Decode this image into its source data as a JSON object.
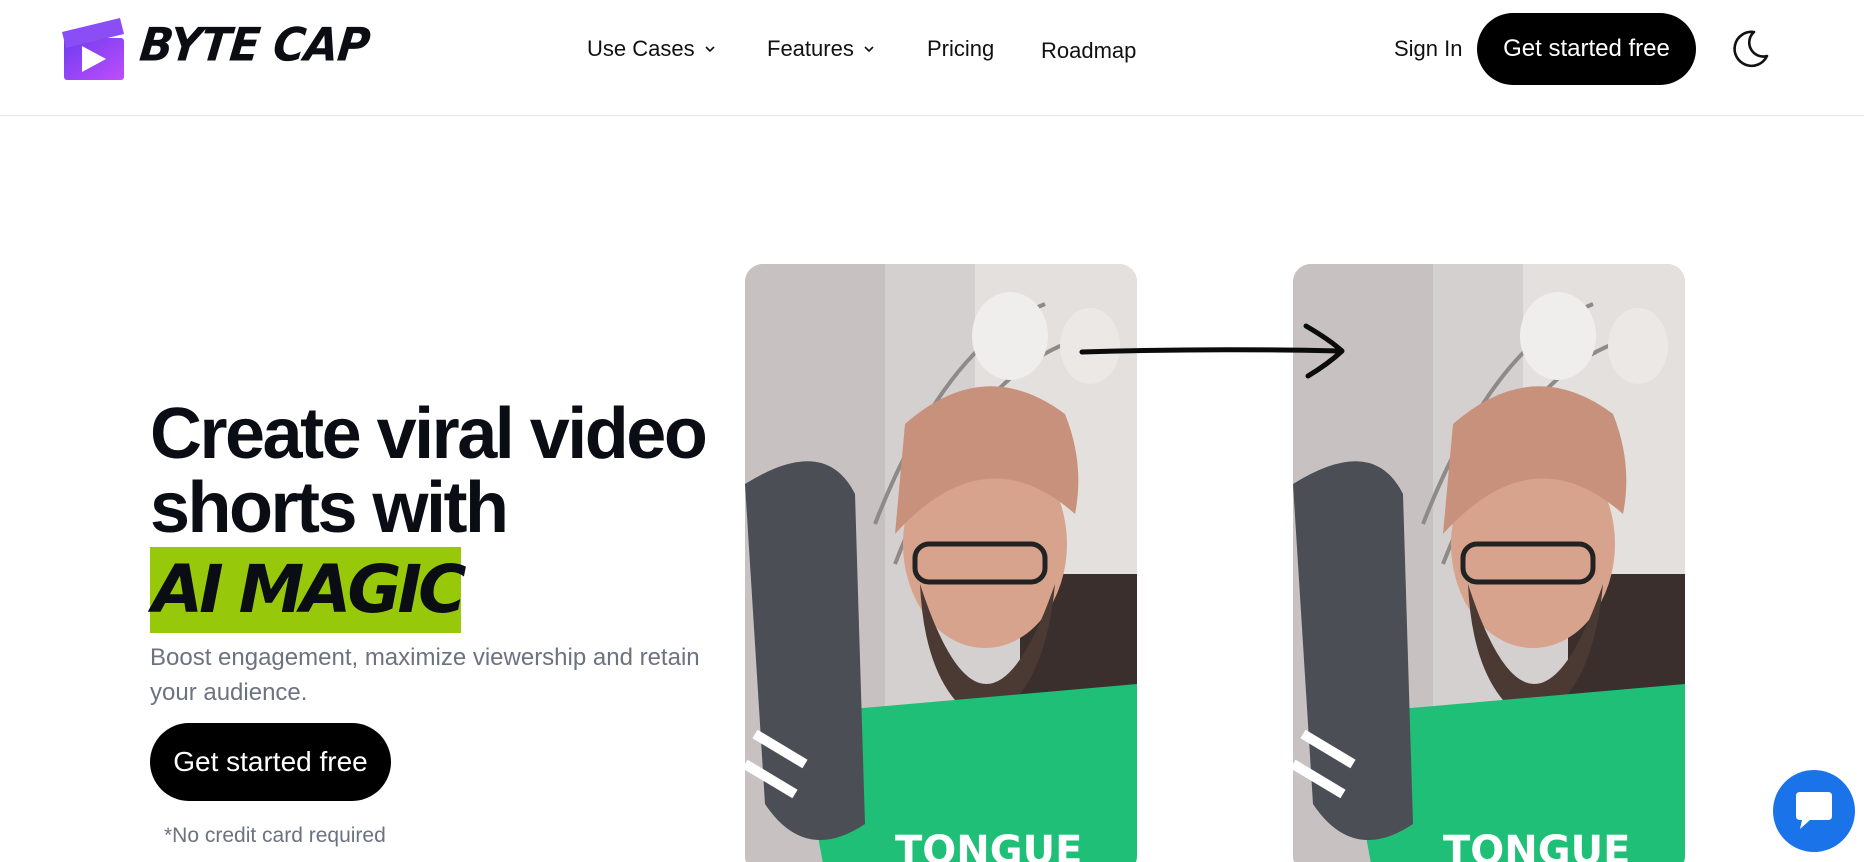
{
  "header": {
    "brand": "BYTE CAP",
    "nav": [
      {
        "label": "Use Cases",
        "dropdown": true
      },
      {
        "label": "Features",
        "dropdown": true
      },
      {
        "label": "Pricing",
        "dropdown": false
      },
      {
        "label": "Roadmap",
        "dropdown": false
      }
    ],
    "sign_in": "Sign In",
    "cta": "Get started free",
    "theme_icon": "moon-icon"
  },
  "hero": {
    "headline_line1": "Create viral video",
    "headline_line2": "shorts with",
    "highlight": "AI MAGIC",
    "subtitle": "Boost engagement, maximize viewership and retain your audience.",
    "cta": "Get started free",
    "note": "*No credit card required",
    "accent_color": "#98c80a"
  },
  "media": {
    "arrow_icon": "arrow-right-icon",
    "shirt_text": "TONGUE"
  },
  "chat": {
    "icon": "chat-icon",
    "color": "#1a73e8"
  }
}
